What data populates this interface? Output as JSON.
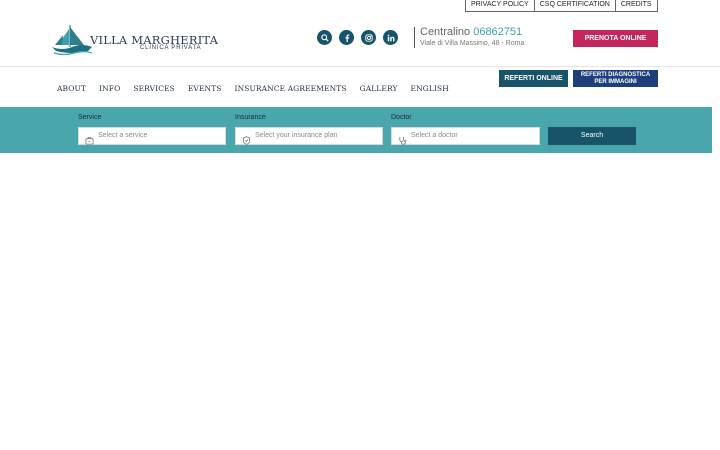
{
  "toplinks": [
    "PRIVACY POLICY",
    "CSQ CERTIFICATION",
    "CREDITS"
  ],
  "logo": {
    "title": "VILLA MARGHERITA",
    "subtitle": "CLINICA PRIVATA"
  },
  "socials": [
    "search-icon",
    "facebook-icon",
    "instagram-icon",
    "linkedin-icon"
  ],
  "contact": {
    "label": "Centralino",
    "phone": "06862751",
    "address": "Viale di Villa Massimo, 48 - Roma"
  },
  "prenota_label": "PRENOTA ONLINE",
  "nav": [
    "ABOUT",
    "INFO",
    "SERVICES",
    "EVENTS",
    "INSURANCE AGREEMENTS",
    "GALLERY",
    "ENGLISH"
  ],
  "referti_label": "REFERTI ONLINE",
  "referti_diag": {
    "line1": "REFERTI DIAGNOSTICA",
    "line2": "PER IMMAGINI"
  },
  "colors": {
    "brand_teal": "#4aa6ad",
    "dark_teal": "#17546a",
    "magenta": "#c5265f",
    "navy": "#1d3f7a"
  },
  "search": {
    "service": {
      "label": "Service",
      "placeholder": "Select a service",
      "icon": "briefcase-icon"
    },
    "insurance": {
      "label": "Insurance",
      "placeholder": "Select your insurance plan",
      "icon": "shield-check-icon"
    },
    "doctor": {
      "label": "Doctor",
      "placeholder": "Select a doctor",
      "icon": "stethoscope-icon"
    },
    "button": "Search"
  }
}
